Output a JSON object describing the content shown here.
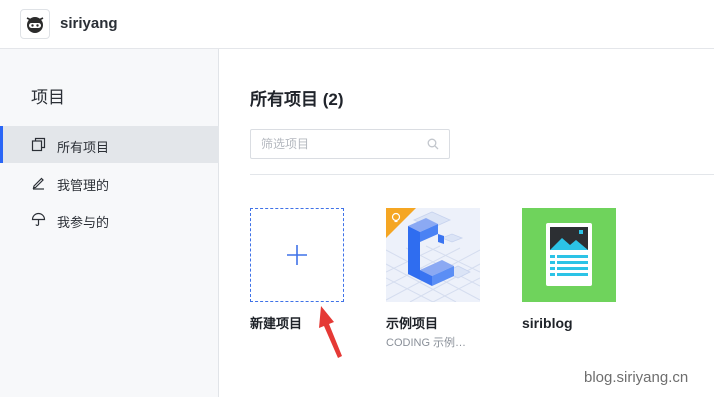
{
  "header": {
    "username": "siriyang"
  },
  "sidebar": {
    "title": "项目",
    "items": [
      {
        "label": "所有项目",
        "icon": "copy-icon",
        "active": true
      },
      {
        "label": "我管理的",
        "icon": "edit-icon",
        "active": false
      },
      {
        "label": "我参与的",
        "icon": "umbrella-icon",
        "active": false
      }
    ]
  },
  "main": {
    "title": "所有项目 (2)",
    "filter": {
      "placeholder": "筛选项目",
      "value": ""
    },
    "cards": [
      {
        "name": "新建项目",
        "desc": "",
        "type": "new"
      },
      {
        "name": "示例项目",
        "desc": "CODING 示例…",
        "type": "demo"
      },
      {
        "name": "siriblog",
        "desc": "",
        "type": "siriblog"
      }
    ]
  },
  "annotation": {
    "arrow_color": "#e53935"
  },
  "watermark": "blog.siriyang.cn",
  "colors": {
    "accent": "#2a66f6",
    "sidebar_bg": "#f7f8fa",
    "siriblog_bg": "#6fd35c",
    "demo_badge": "#f5a623"
  }
}
